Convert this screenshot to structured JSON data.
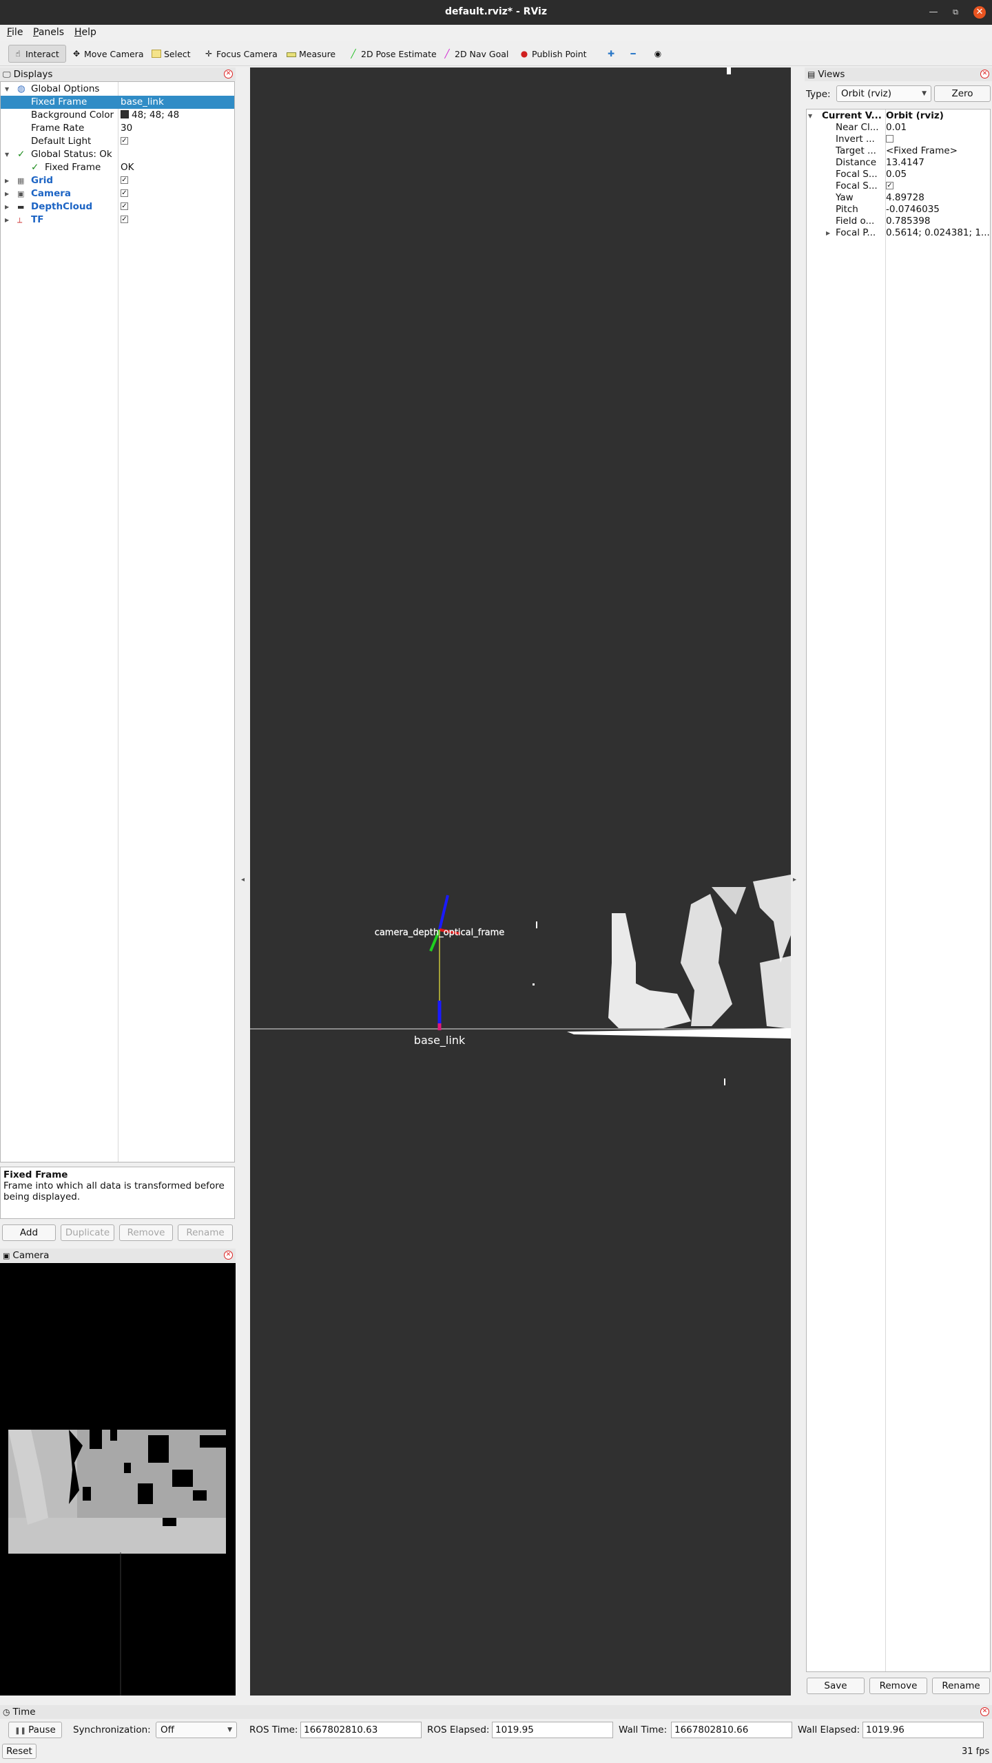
{
  "window": {
    "title": "default.rviz* - RViz"
  },
  "menu": [
    "File",
    "Panels",
    "Help"
  ],
  "toolbar": {
    "tools": [
      "Interact",
      "Move Camera",
      "Select",
      "Focus Camera",
      "Measure",
      "2D Pose Estimate",
      "2D Nav Goal",
      "Publish Point"
    ]
  },
  "displays": {
    "title": "Displays",
    "rows": [
      {
        "label": "Global Options",
        "value": ""
      },
      {
        "label": "Fixed Frame",
        "value": "base_link"
      },
      {
        "label": "Background Color",
        "value": "48; 48; 48"
      },
      {
        "label": "Frame Rate",
        "value": "30"
      },
      {
        "label": "Default Light",
        "value": ""
      },
      {
        "label": "Global Status: Ok",
        "value": ""
      },
      {
        "label": "Fixed Frame",
        "value": "OK"
      },
      {
        "label": "Grid",
        "value": ""
      },
      {
        "label": "Camera",
        "value": ""
      },
      {
        "label": "DepthCloud",
        "value": ""
      },
      {
        "label": "TF",
        "value": ""
      }
    ],
    "description_title": "Fixed Frame",
    "description_text": "Frame into which all data is transformed before being displayed.",
    "buttons": [
      "Add",
      "Duplicate",
      "Remove",
      "Rename"
    ]
  },
  "camera_panel": {
    "title": "Camera"
  },
  "viewport": {
    "frame_label_base": "base_link",
    "frame_label_camera": "camera_depth_optical_frame",
    "background_color": "#303030"
  },
  "views": {
    "title": "Views",
    "type_label": "Type:",
    "type_value": "Orbit (rviz)",
    "zero_label": "Zero",
    "rows": [
      {
        "label": "Current V...",
        "value": "Orbit (rviz)"
      },
      {
        "label": "Near Cl...",
        "value": "0.01"
      },
      {
        "label": "Invert ...",
        "value": ""
      },
      {
        "label": "Target ...",
        "value": "<Fixed Frame>"
      },
      {
        "label": "Distance",
        "value": "13.4147"
      },
      {
        "label": "Focal S...",
        "value": "0.05"
      },
      {
        "label": "Focal S...",
        "value": ""
      },
      {
        "label": "Yaw",
        "value": "4.89728"
      },
      {
        "label": "Pitch",
        "value": "-0.0746035"
      },
      {
        "label": "Field o...",
        "value": "0.785398"
      },
      {
        "label": "Focal P...",
        "value": "0.5614; 0.024381; 1...."
      }
    ],
    "buttons": [
      "Save",
      "Remove",
      "Rename"
    ]
  },
  "time": {
    "title": "Time",
    "pause_label": "Pause",
    "sync_label": "Synchronization:",
    "sync_value": "Off",
    "ros_time_label": "ROS Time:",
    "ros_time_value": "1667802810.63",
    "ros_elapsed_label": "ROS Elapsed:",
    "ros_elapsed_value": "1019.95",
    "wall_time_label": "Wall Time:",
    "wall_time_value": "1667802810.66",
    "wall_elapsed_label": "Wall Elapsed:",
    "wall_elapsed_value": "1019.96",
    "reset_label": "Reset",
    "fps": "31 fps"
  },
  "colors": {
    "accent": "#308cc6",
    "title_bar": "#2c2c2c",
    "close": "#e95420"
  }
}
